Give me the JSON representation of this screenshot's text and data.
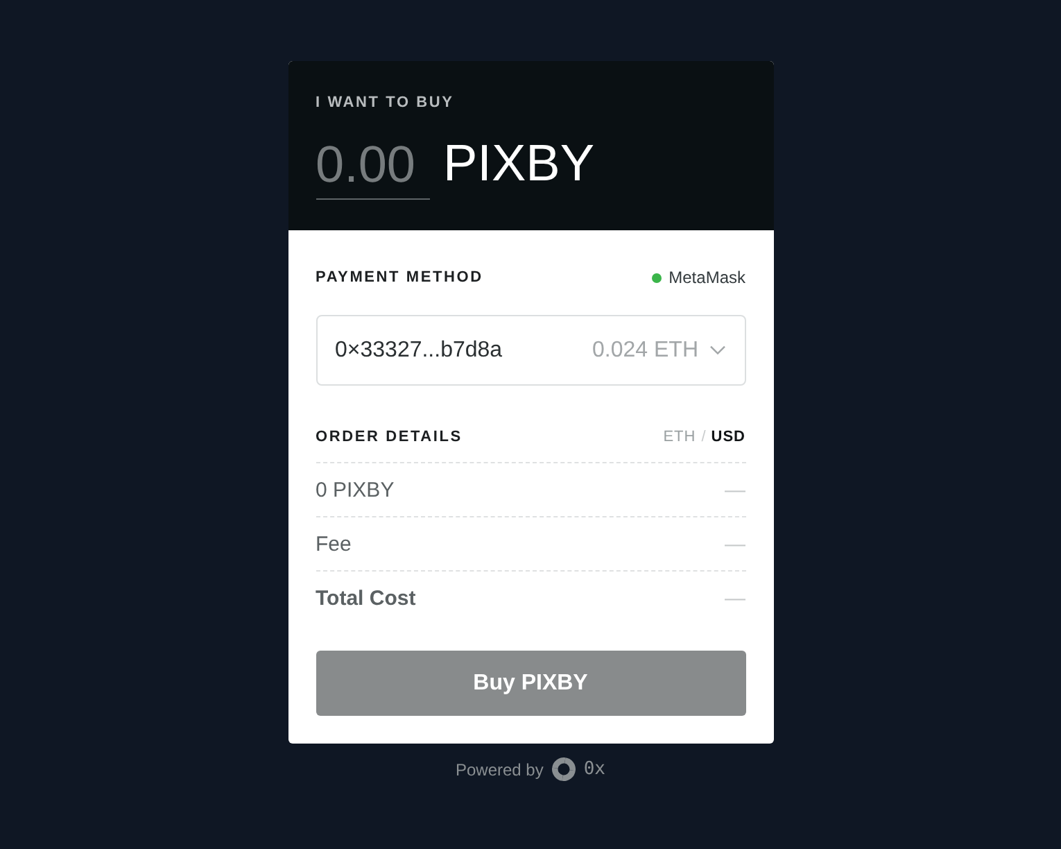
{
  "header": {
    "label": "I WANT TO BUY",
    "amount": {
      "placeholder": "0.00"
    },
    "token": "PIXBY"
  },
  "payment": {
    "title": "PAYMENT METHOD",
    "wallet": {
      "name": "MetaMask",
      "connected": true
    },
    "account": {
      "address": "0×33327...b7d8a",
      "balance": "0.024 ETH"
    }
  },
  "order": {
    "title": "ORDER DETAILS",
    "currencies": [
      {
        "label": "ETH",
        "selected": false
      },
      {
        "label": "USD",
        "selected": true
      }
    ],
    "separator": "/",
    "rows": [
      {
        "kind": "item",
        "label": "0 PIXBY",
        "value": "—"
      },
      {
        "kind": "item",
        "label": "Fee",
        "value": "—"
      },
      {
        "kind": "total",
        "label": "Total Cost",
        "value": "—"
      }
    ]
  },
  "buy_button": {
    "label": "Buy PIXBY",
    "disabled": true
  },
  "footer": {
    "text": "Powered by",
    "brand": "0x"
  }
}
